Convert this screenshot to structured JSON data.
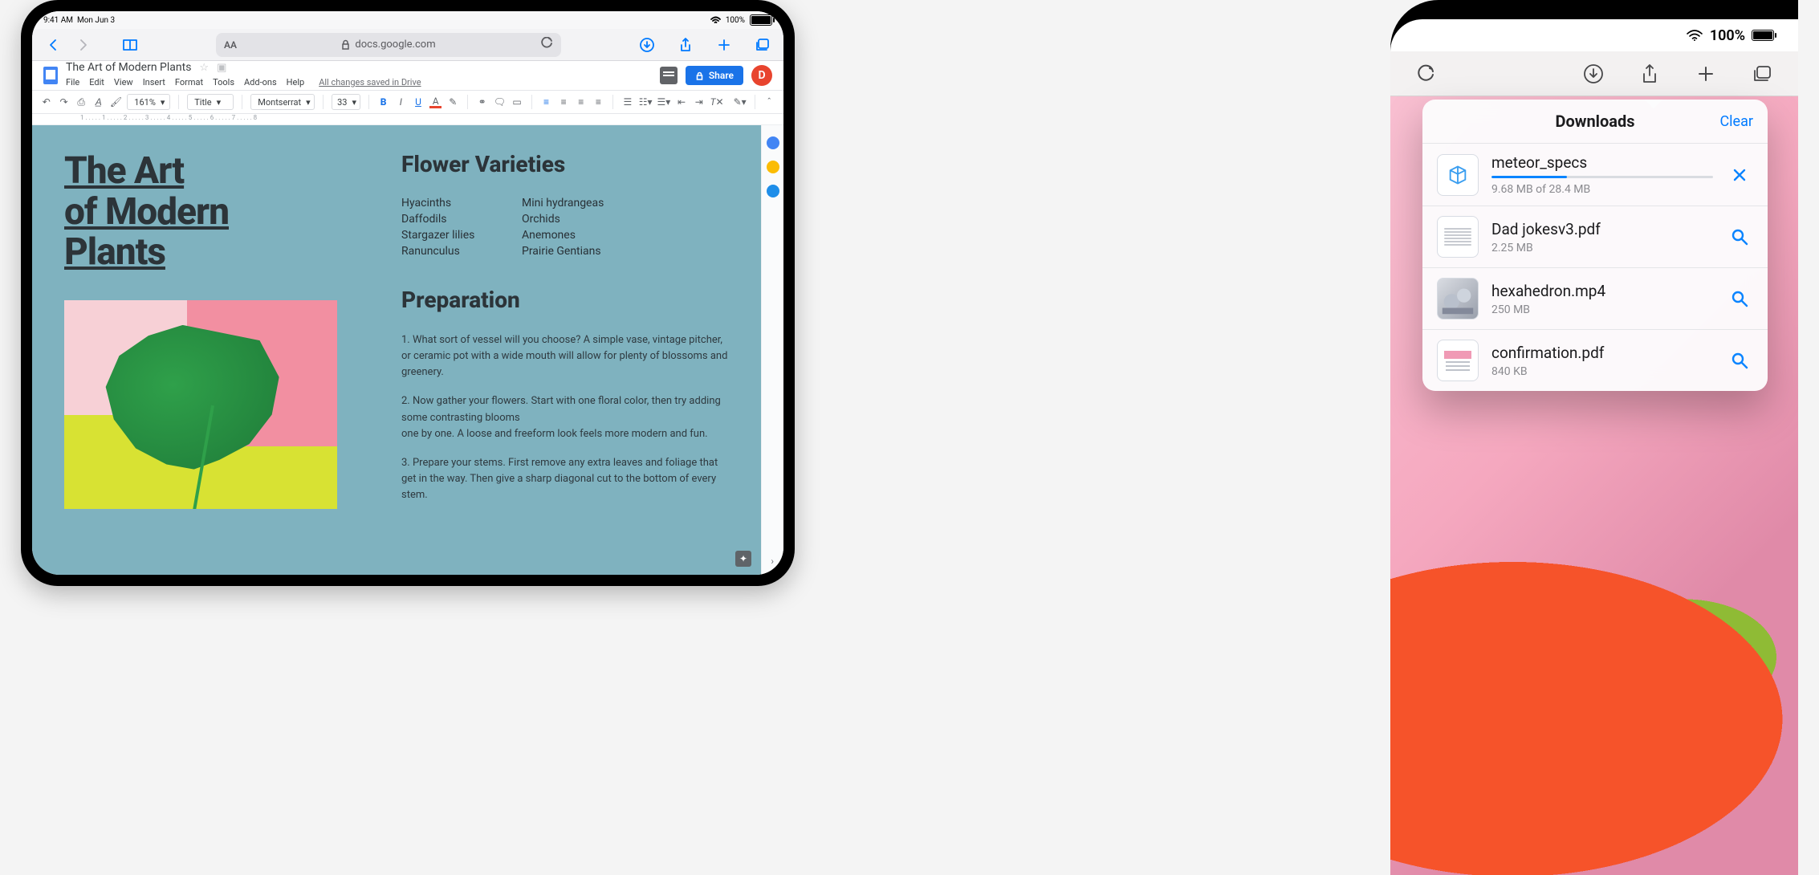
{
  "left": {
    "status": {
      "time": "9:41 AM",
      "date": "Mon Jun 3",
      "battery": "100%"
    },
    "safari": {
      "url": "docs.google.com"
    },
    "gdoc": {
      "title": "The Art of Modern Plants",
      "menus": [
        "File",
        "Edit",
        "View",
        "Insert",
        "Format",
        "Tools",
        "Add-ons",
        "Help"
      ],
      "save_note": "All changes saved in Drive",
      "share": "Share",
      "avatar_letter": "D",
      "zoom": "161%",
      "style": "Title",
      "font": "Montserrat",
      "font_size": "33"
    },
    "ruler": "1 . . . . . 1 . . . . . 2 . . . . . 3 . . . . . 4 . . . . . 5 . . . . . 6 . . . . . 7 . . . . . 8",
    "doc": {
      "title_l1": "The Art",
      "title_l2": "of Modern",
      "title_l3": "Plants",
      "sec1": "Flower Varieties",
      "flowers_left": [
        "Hyacinths",
        "Daffodils",
        "Stargazer lilies",
        "Ranunculus"
      ],
      "flowers_right": [
        "Mini hydrangeas",
        "Orchids",
        "Anemones",
        "Prairie Gentians"
      ],
      "sec2": "Preparation",
      "p1": "1. What sort of vessel will you choose? A simple vase, vintage pitcher, or ceramic pot with a wide mouth will allow for plenty of blossoms and greenery.",
      "p2a": "2. Now gather your flowers. Start with one floral color, then try adding some contrasting blooms",
      "p2b": "one by one. A loose and freeform look feels more modern and fun.",
      "p3": "3. Prepare your stems. First remove any extra leaves and foliage that get in the way. Then give a sharp diagonal cut to the bottom of every stem."
    }
  },
  "right": {
    "status_battery": "100%",
    "popover": {
      "title": "Downloads",
      "clear": "Clear",
      "items": [
        {
          "name": "meteor_specs",
          "sub": "9.68 MB of 28.4 MB",
          "progress": 34,
          "action": "cancel",
          "thumb": "ar"
        },
        {
          "name": "Dad jokesv3.pdf",
          "sub": "2.25 MB",
          "action": "reveal",
          "thumb": "doc"
        },
        {
          "name": "hexahedron.mp4",
          "sub": "250 MB",
          "action": "reveal",
          "thumb": "vid"
        },
        {
          "name": "confirmation.pdf",
          "sub": "840 KB",
          "action": "reveal",
          "thumb": "conf"
        }
      ]
    }
  }
}
